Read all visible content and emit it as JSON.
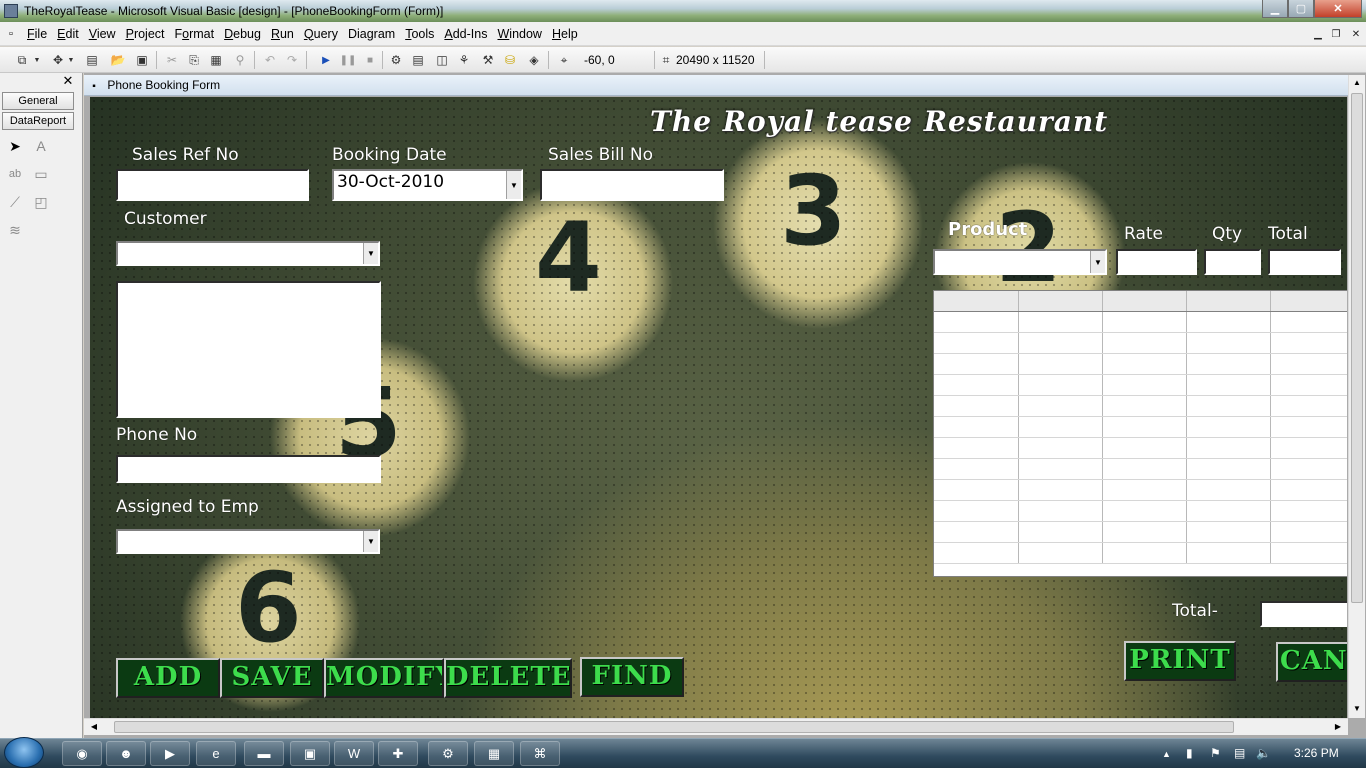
{
  "window": {
    "title": "TheRoyalTease - Microsoft Visual Basic [design] - [PhoneBookingForm (Form)]"
  },
  "menu": [
    {
      "label": "File",
      "u": "F"
    },
    {
      "label": "Edit",
      "u": "E"
    },
    {
      "label": "View",
      "u": "V"
    },
    {
      "label": "Project",
      "u": "P"
    },
    {
      "label": "Format",
      "u": "o"
    },
    {
      "label": "Debug",
      "u": "D"
    },
    {
      "label": "Run",
      "u": "R"
    },
    {
      "label": "Query",
      "u": "Q"
    },
    {
      "label": "Diagram",
      "u": "g"
    },
    {
      "label": "Tools",
      "u": "T"
    },
    {
      "label": "Add-Ins",
      "u": "A"
    },
    {
      "label": "Window",
      "u": "W"
    },
    {
      "label": "Help",
      "u": "H"
    }
  ],
  "toolbar": {
    "position": "-60, 0",
    "size": "20490 x 11520"
  },
  "toolbox": {
    "tab_general": "General",
    "tab_datareport": "DataReport"
  },
  "child_window": {
    "title": "Phone Booking Form"
  },
  "form": {
    "brand_title": "The Royal tease Restaurant",
    "labels": {
      "sales_ref": "Sales Ref No",
      "booking_date": "Booking Date",
      "sales_bill": "Sales Bill No",
      "customer": "Customer",
      "phone": "Phone No",
      "assigned": "Assigned to Emp",
      "product": "Product",
      "rate": "Rate",
      "qty": "Qty",
      "total_col": "Total",
      "total": "Total-"
    },
    "booking_date_value": "30-Oct-2010",
    "buttons": {
      "add": "ADD",
      "save": "SAVE",
      "modify": "MODIFY",
      "delete": "DELETE",
      "find": "FIND",
      "print": "PRINT",
      "cancel": "CANC"
    }
  },
  "taskbar": {
    "clock": "3:26 PM"
  }
}
